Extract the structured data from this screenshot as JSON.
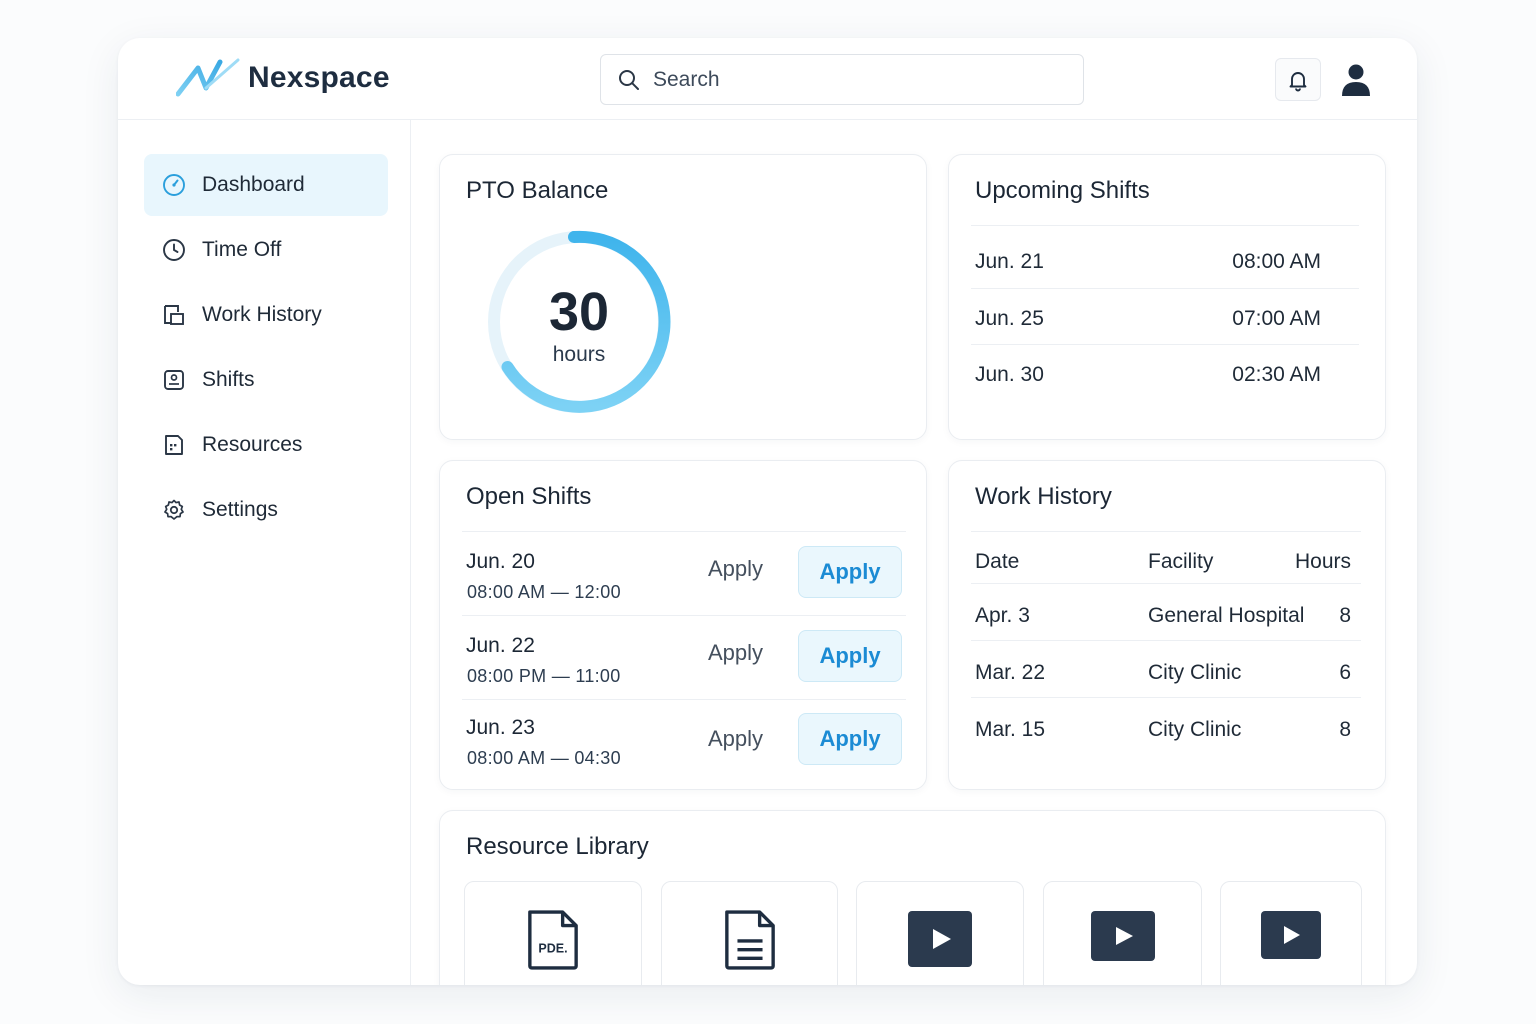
{
  "brand": {
    "name": "Nexspace",
    "accent": "#4fb8ea"
  },
  "search": {
    "placeholder": "Search"
  },
  "sidebar": {
    "items": [
      {
        "label": "Dashboard",
        "icon": "dashboard-icon",
        "active": true
      },
      {
        "label": "Time Off",
        "icon": "clock-icon"
      },
      {
        "label": "Work History",
        "icon": "work-history-icon"
      },
      {
        "label": "Shifts",
        "icon": "shifts-icon"
      },
      {
        "label": "Resources",
        "icon": "resources-icon"
      },
      {
        "label": "Settings",
        "icon": "gear-icon"
      }
    ]
  },
  "pto": {
    "title": "PTO Balance",
    "value": "30",
    "unit": "hours"
  },
  "upcoming": {
    "title": "Upcoming Shifts",
    "rows": [
      {
        "date": "Jun. 21",
        "time": "08:00 AM"
      },
      {
        "date": "Jun. 25",
        "time": "07:00 AM"
      },
      {
        "date": "Jun. 30",
        "time": "02:30 AM"
      }
    ]
  },
  "open_shifts": {
    "title": "Open Shifts",
    "rows": [
      {
        "date": "Jun. 20",
        "time": "08:00 AM — 12:00",
        "link": "Apply",
        "button": "Apply"
      },
      {
        "date": "Jun. 22",
        "time": "08:00 PM — 11:00",
        "link": "Apply",
        "button": "Apply"
      },
      {
        "date": "Jun. 23",
        "time": "08:00 AM — 04:30",
        "link": "Apply",
        "button": "Apply"
      }
    ]
  },
  "work_history": {
    "title": "Work History",
    "headers": [
      "Date",
      "Facility",
      "Hours"
    ],
    "rows": [
      [
        "Apr. 3",
        "General Hospital",
        "8"
      ],
      [
        "Mar. 22",
        "City Clinic",
        "6"
      ],
      [
        "Mar. 15",
        "City Clinic",
        "8"
      ]
    ]
  },
  "library": {
    "title": "Resource Library",
    "items": [
      {
        "icon": "pdf-file-icon",
        "label": "PDE."
      },
      {
        "icon": "document-icon"
      },
      {
        "icon": "video-icon"
      },
      {
        "icon": "video-icon"
      },
      {
        "icon": "video-icon"
      }
    ]
  }
}
